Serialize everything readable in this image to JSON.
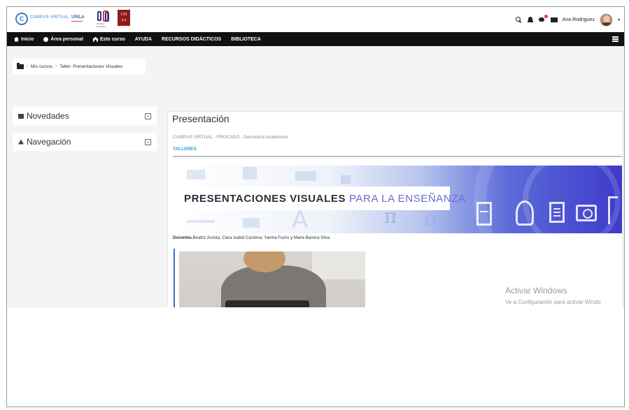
{
  "header": {
    "logo_circle": "C",
    "logo_text": "CAMPUS VIRTUAL",
    "logo_unla": "UNLa",
    "mark_caption": "30 años Fundados",
    "logo_un_top": "UN",
    "logo_un_bottom": "La",
    "user_name": "Ana Rodriguez",
    "icons": [
      "search-icon",
      "bell-icon",
      "chat-icon",
      "mail-icon"
    ]
  },
  "nav": {
    "items": [
      {
        "label": "Inicio",
        "icon": "home-icon"
      },
      {
        "label": "Área personal",
        "icon": "users-icon"
      },
      {
        "label": "Este curso",
        "icon": "sitemap-icon"
      },
      {
        "label": "AYUDA"
      },
      {
        "label": "RECURSOS DIDÁCTICOS"
      },
      {
        "label": "BIBLIOTECA"
      }
    ]
  },
  "breadcrumb": {
    "items": [
      "Mis cursos",
      "Taller: Presentaciones Visuales"
    ]
  },
  "blocks": [
    {
      "title": "Novedades",
      "icon": "calendar-icon"
    },
    {
      "title": "Navegación",
      "icon": "sitemap-icon"
    }
  ],
  "main": {
    "title": "Presentación",
    "meta": "CAMPUS VIRTUAL - PROCADO - Secretaría Académica",
    "section": "TALLERES",
    "banner_strong": "PRESENTACIONES VISUALES",
    "banner_light": "PARA LA ENSEÑANZA",
    "docentes_label": "Docentes",
    "docentes_names": ",Beatriz Acosta, Clara Isabel Cardona, Yanina Fuchs y Maira Barrera Silva"
  },
  "watermark": {
    "title": "Activar Windows",
    "subtitle": "Ve a Configuración para activar Windo"
  },
  "colors": {
    "navbar": "#111111",
    "accent": "#2a9fd6",
    "banner_blue": "#3d3acb"
  }
}
